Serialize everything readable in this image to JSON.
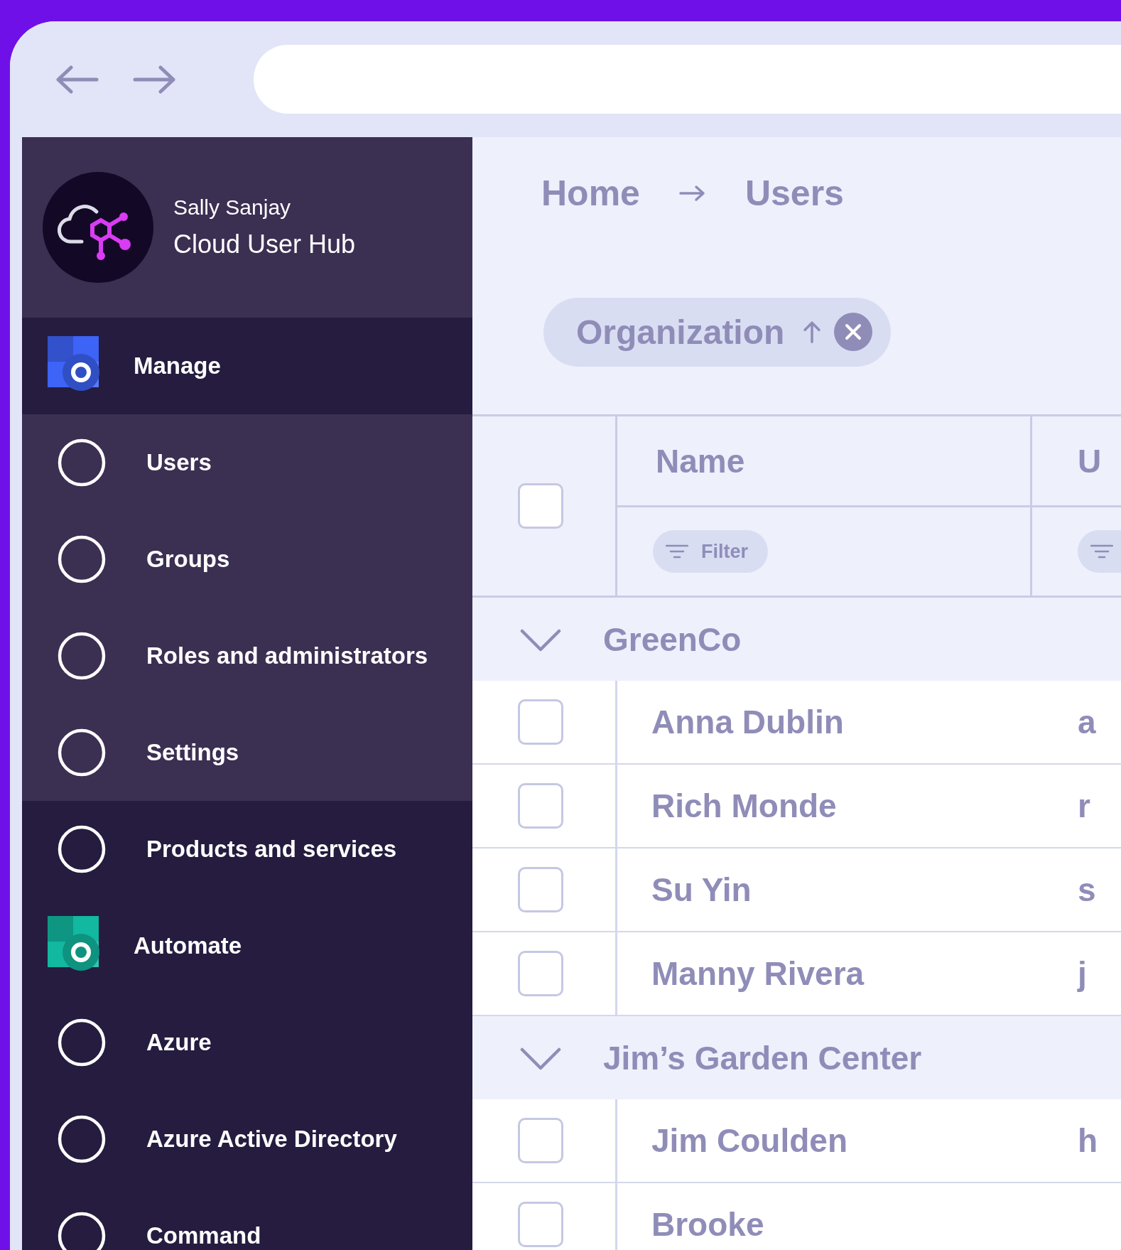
{
  "sidebar": {
    "account": {
      "user": "Sally Sanjay",
      "product": "Cloud User Hub"
    },
    "nav": [
      {
        "label": "Manage",
        "kind": "app",
        "color": "#3d63f7",
        "children": [
          {
            "label": "Users",
            "kind": "page"
          },
          {
            "label": "Groups",
            "kind": "page"
          },
          {
            "label": "Roles and administrators",
            "kind": "page"
          },
          {
            "label": "Settings",
            "kind": "page"
          }
        ]
      },
      {
        "label": "Products and services",
        "kind": "page"
      },
      {
        "label": "Automate",
        "kind": "app",
        "color": "#12b8a0"
      },
      {
        "label": "Azure",
        "kind": "page"
      },
      {
        "label": "Azure Active Directory",
        "kind": "page"
      },
      {
        "label": "Command",
        "kind": "page"
      }
    ]
  },
  "breadcrumb": [
    "Home",
    "Users"
  ],
  "sort_chip": {
    "label": "Organization"
  },
  "table": {
    "select_all": {
      "checked": false
    },
    "columns": [
      {
        "label": "Name",
        "filter_label": "Filter"
      },
      {
        "label": "U"
      }
    ],
    "groups": [
      {
        "name": "GreenCo",
        "expanded": true,
        "rows": [
          {
            "name": "Anna Dublin",
            "column_3": "a",
            "checked": false
          },
          {
            "name": "Rich Monde",
            "column_3": "r",
            "checked": false
          },
          {
            "name": "Su Yin",
            "column_3": "s",
            "checked": false
          },
          {
            "name": "Manny Rivera",
            "column_3": "j",
            "checked": false
          }
        ]
      },
      {
        "name": "Jim’s Garden Center",
        "expanded": true,
        "rows": [
          {
            "name": "Jim Coulden",
            "column_3": "h",
            "checked": false
          },
          {
            "name": "Brooke",
            "checked": false
          }
        ]
      }
    ]
  }
}
